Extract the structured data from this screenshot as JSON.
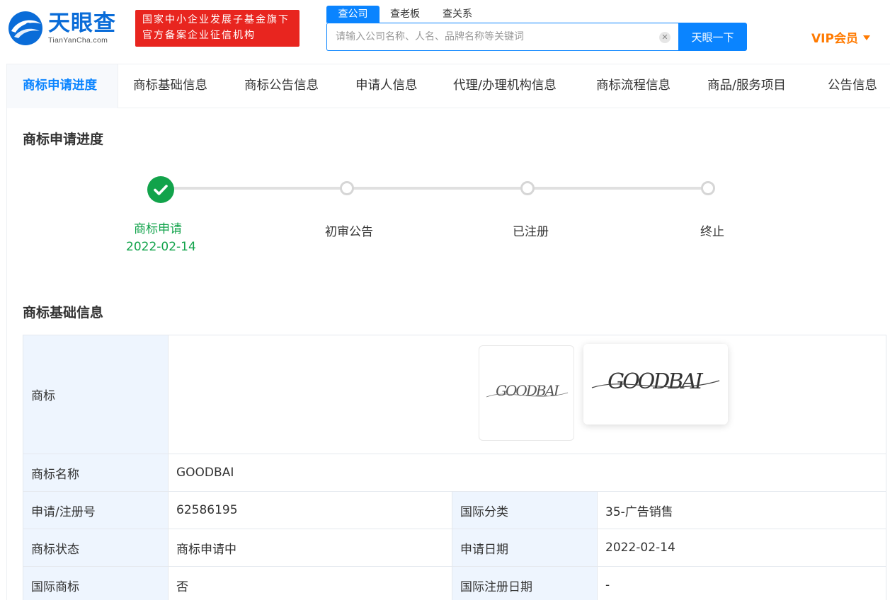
{
  "header": {
    "logo_text": "天眼查",
    "logo_domain": "TianYanCha.com",
    "badge_line1": "国家中小企业发展子基金旗下",
    "badge_line2": "官方备案企业征信机构",
    "search_tabs": [
      "查公司",
      "查老板",
      "查关系"
    ],
    "search_placeholder": "请输入公司名称、人名、品牌名称等关键词",
    "search_button": "天眼一下",
    "vip_label": "VIP会员"
  },
  "nav": {
    "items": [
      "商标申请进度",
      "商标基础信息",
      "商标公告信息",
      "申请人信息",
      "代理/办理机构信息",
      "商标流程信息",
      "商品/服务项目",
      "公告信息"
    ],
    "active_index": 0
  },
  "progress": {
    "title": "商标申请进度",
    "steps": [
      {
        "label": "商标申请",
        "date": "2022-02-14",
        "done": true
      },
      {
        "label": "初审公告",
        "date": "",
        "done": false
      },
      {
        "label": "已注册",
        "date": "",
        "done": false
      },
      {
        "label": "终止",
        "date": "",
        "done": false
      }
    ]
  },
  "basic_info": {
    "title": "商标基础信息",
    "trademark_label": "商标",
    "trademark_wordmark": "GOODBAI",
    "rows": [
      {
        "label": "商标名称",
        "value": "GOODBAI"
      },
      {
        "label": "申请/注册号",
        "value": "62586195",
        "label2": "国际分类",
        "value2": "35-广告销售"
      },
      {
        "label": "商标状态",
        "value": "商标申请中",
        "label2": "申请日期",
        "value2": "2022-02-14"
      },
      {
        "label": "国际商标",
        "value": "否",
        "label2": "国际注册日期",
        "value2": "-"
      }
    ]
  },
  "colors": {
    "brand_blue": "#0a84ff",
    "logo_blue": "#0a6cd8",
    "badge_red": "#e8251f",
    "vip_orange": "#ff7a00",
    "done_green": "#12a34b",
    "label_bg": "#eef5fe"
  }
}
